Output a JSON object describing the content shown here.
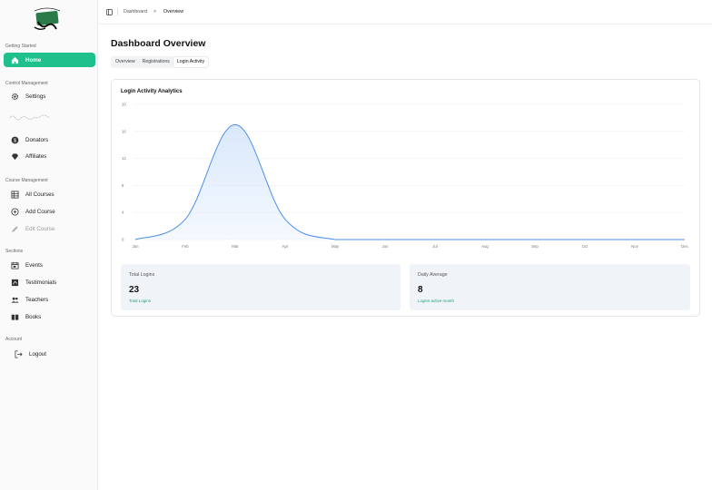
{
  "sidebar": {
    "sections": {
      "getting_started": "Getting Started",
      "control": "Control Management",
      "course": "Course Management",
      "sections": "Sections",
      "account": "Account"
    },
    "items": {
      "home": "Home",
      "settings": "Settings",
      "donators": "Donators",
      "affiliates": "Affiliates",
      "all_courses": "All Courses",
      "add_course": "Add Course",
      "edit_course": "Edit Course",
      "events": "Events",
      "testimonials": "Testimonials",
      "teachers": "Teachers",
      "books": "Books",
      "logout": "Logout"
    }
  },
  "header": {
    "breadcrumb_root": "Dashboard",
    "breadcrumb_sep": ">",
    "breadcrumb_current": "Overview"
  },
  "main": {
    "title": "Dashboard Overview",
    "tabs": [
      "Overview",
      "Registrations",
      "Login Activity"
    ],
    "active_tab": "Login Activity",
    "card_title": "Login Activity Analytics",
    "stats": [
      {
        "label": "Total Logins",
        "value": "23",
        "sub": "Total Logins"
      },
      {
        "label": "Daily Average",
        "value": "8",
        "sub": "Logins active month"
      }
    ]
  },
  "colors": {
    "accent": "#1fc08c",
    "line": "#4a8fe7",
    "fill": "#d9e8fb"
  },
  "chart_data": {
    "type": "area",
    "title": "Login Activity Analytics",
    "categories": [
      "Jan",
      "Feb",
      "Mar",
      "Apr",
      "May",
      "Jun",
      "Jul",
      "Aug",
      "Sep",
      "Oct",
      "Nov",
      "Dec"
    ],
    "values": [
      0,
      3,
      17,
      3,
      0,
      0,
      0,
      0,
      0,
      0,
      0,
      0
    ],
    "yticks": [
      "0",
      "4",
      "8",
      "12",
      "16",
      "20"
    ],
    "ylim": [
      0,
      20
    ],
    "grid": true
  }
}
